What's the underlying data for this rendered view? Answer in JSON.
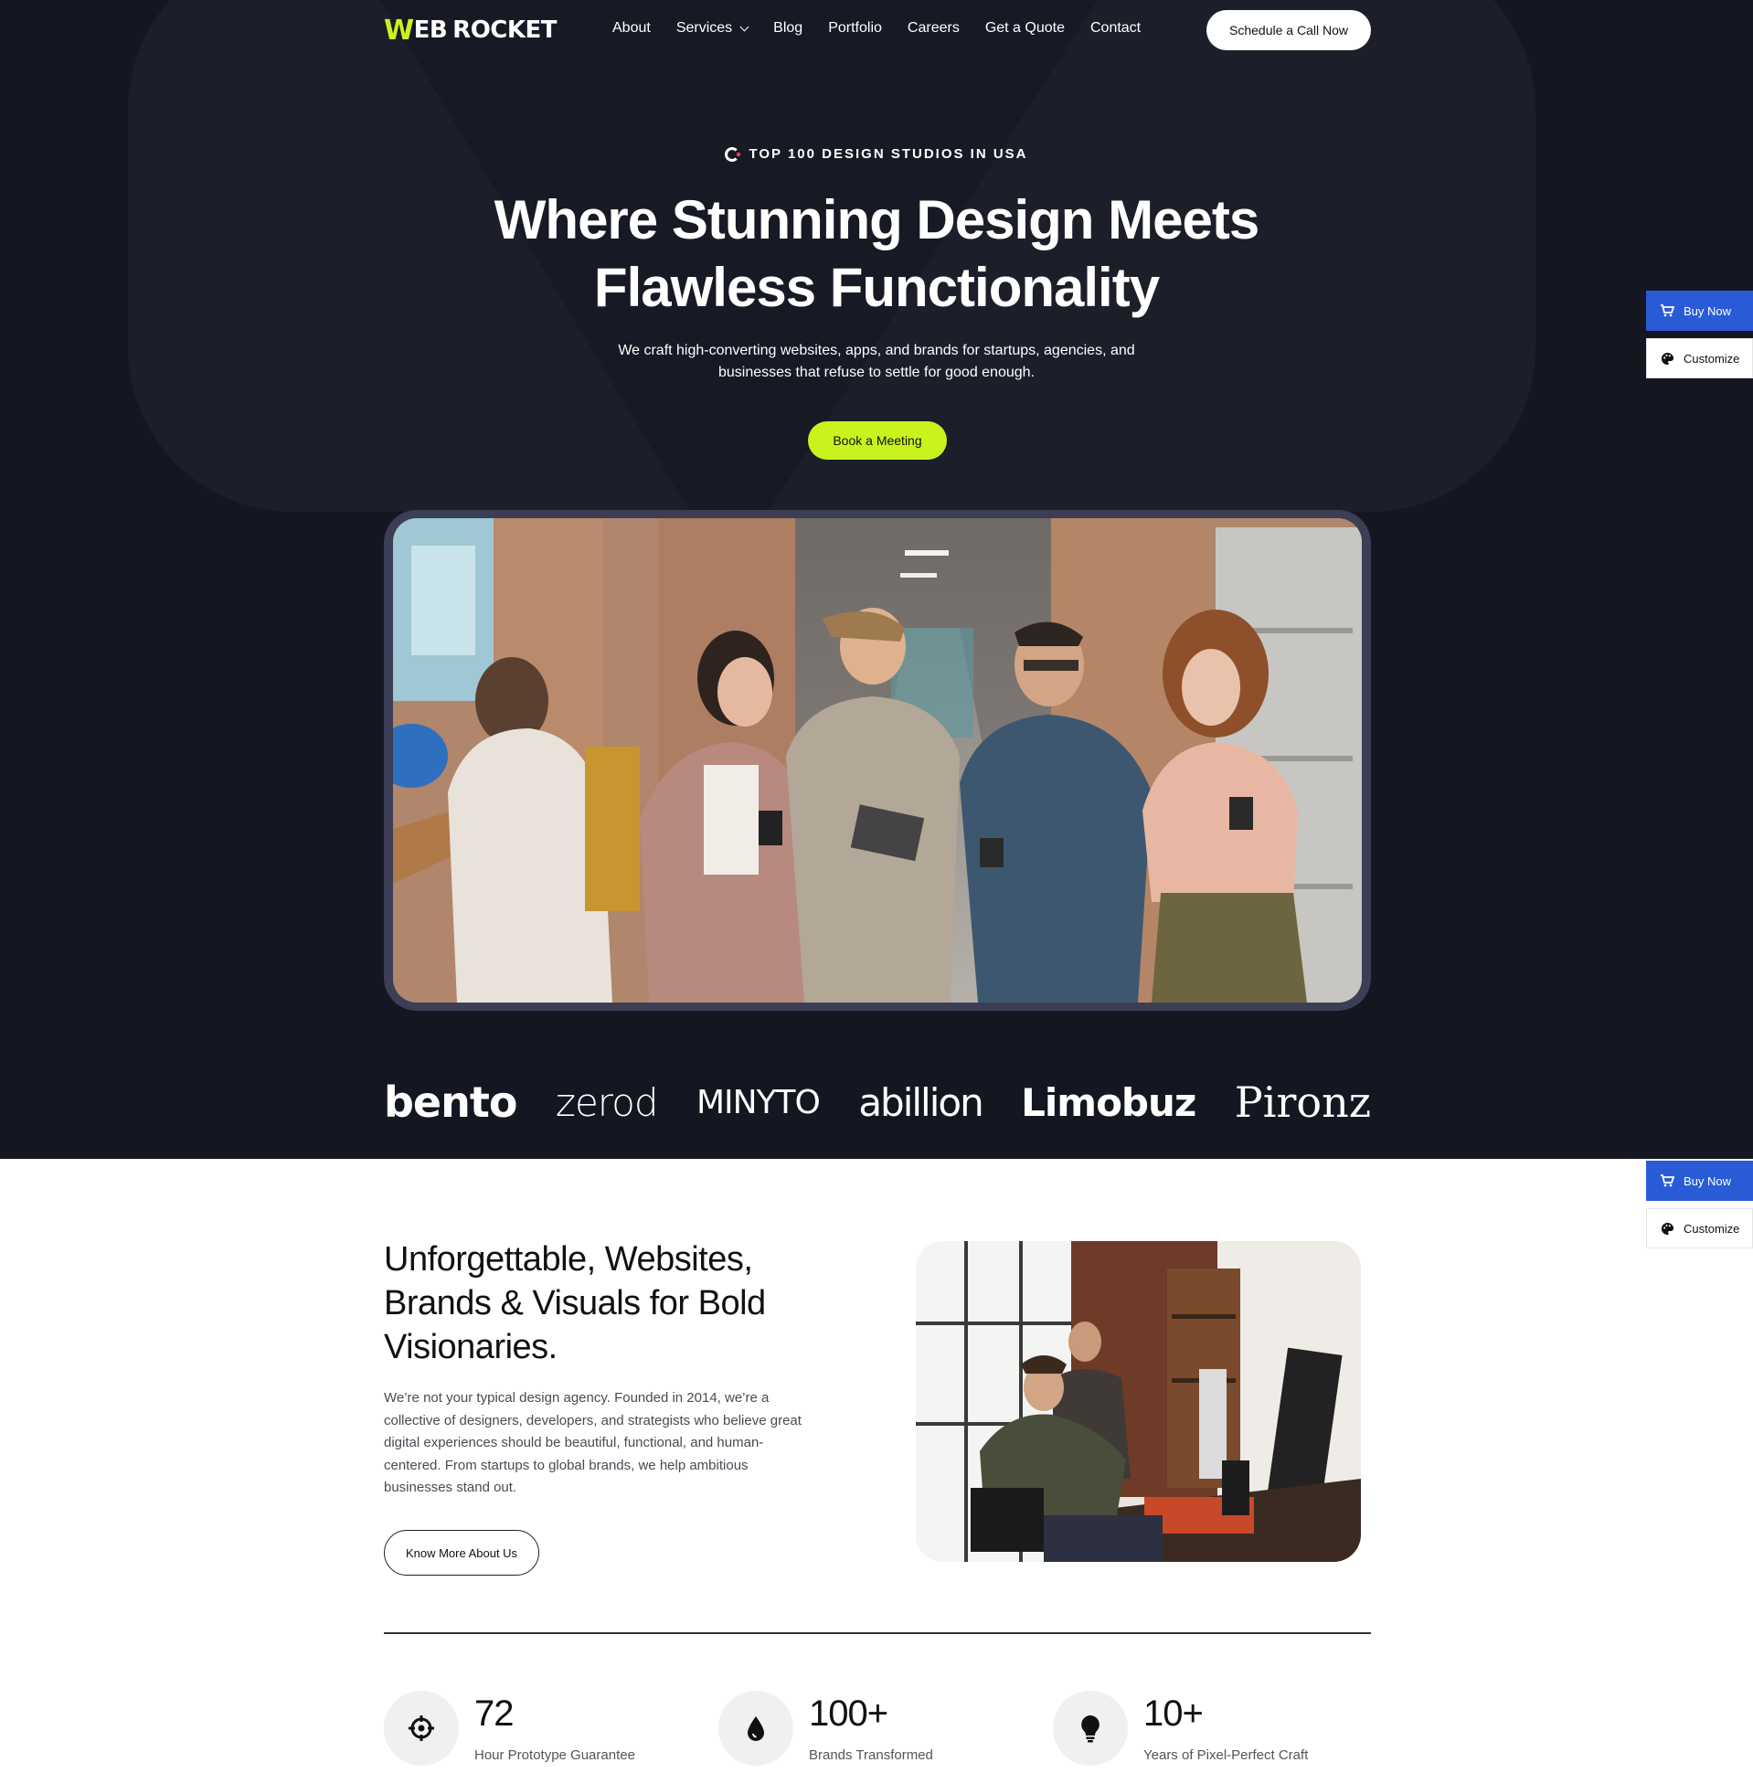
{
  "nav": {
    "logo_w": "W",
    "logo_eb": "EB",
    "logo_rocket": "ROCKET",
    "items": [
      {
        "label": "About"
      },
      {
        "label": "Services"
      },
      {
        "label": "Blog"
      },
      {
        "label": "Portfolio"
      },
      {
        "label": "Careers"
      },
      {
        "label": "Get a Quote"
      },
      {
        "label": "Contact"
      }
    ],
    "cta": "Schedule a Call Now"
  },
  "hero": {
    "badge": "TOP 100 DESIGN STUDIOS IN USA",
    "headline_line1": "Where Stunning Design Meets",
    "headline_line2": "Flawless Functionality",
    "sub_line1": "We craft high-converting websites, apps, and brands for startups, agencies, and",
    "sub_line2": "businesses that refuse to settle for good enough.",
    "cta": "Book a Meeting"
  },
  "brands": [
    "bento",
    "zerod",
    "MINYTO",
    "abillion",
    "Limobuz",
    "Pironz"
  ],
  "side_panel": {
    "buy": "Buy Now",
    "customize": "Customize"
  },
  "about": {
    "title_line1": "Unforgettable, Websites,",
    "title_line2": "Brands & Visuals for Bold",
    "title_line3": "Visionaries.",
    "text_line1": "We’re not your typical design agency. Founded in 2014, we’re a",
    "text_line2": "collective of designers, developers, and strategists who believe great",
    "text_line3": "digital experiences should be beautiful, functional, and human-",
    "text_line4": "centered. From startups to global brands, we help ambitious",
    "text_line5": "businesses stand out.",
    "cta": "Know More About Us"
  },
  "stats": [
    {
      "value": "72",
      "label": "Hour Prototype Guarantee",
      "icon": "crosshair-icon"
    },
    {
      "value": "100+",
      "label": "Brands Transformed",
      "icon": "drop-icon"
    },
    {
      "value": "10+",
      "label": "Years of Pixel-Perfect Craft",
      "icon": "lightbulb-icon"
    }
  ],
  "colors": {
    "dark_bg": "#141621",
    "accent_lime": "#c8f31d",
    "side_blue": "#2a5bd7"
  }
}
